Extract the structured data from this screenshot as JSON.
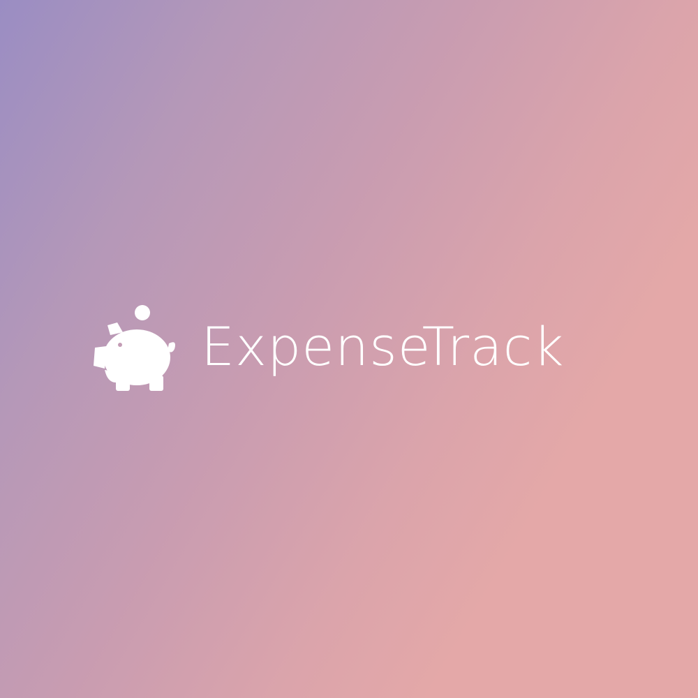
{
  "app": {
    "name": "ExpenseTrack",
    "logo_icon": "piggy-bank-icon"
  },
  "colors": {
    "gradient_start": "#9a8dc3",
    "gradient_end": "#e4a8a8",
    "foreground": "#ffffff"
  }
}
